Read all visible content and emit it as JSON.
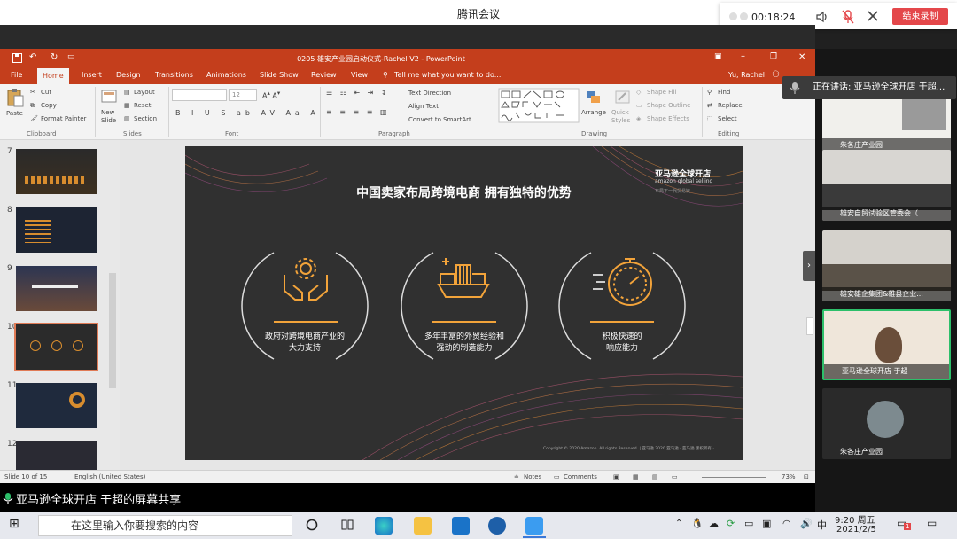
{
  "meeting": {
    "title": "腾讯会议",
    "time": "00:18:24",
    "end_label": "结束录制",
    "speaking_prefix": "正在讲话: 亚马逊全球开店 于超..."
  },
  "ppt": {
    "window_title": "0205 雄安产业园启动仪式-Rachel V2 - PowerPoint",
    "user": "Yu, Rachel",
    "tabs": [
      "File",
      "Home",
      "Insert",
      "Design",
      "Transitions",
      "Animations",
      "Slide Show",
      "Review",
      "View"
    ],
    "tell_me": "Tell me what you want to do...",
    "clipboard": {
      "paste": "Paste",
      "cut": "Cut",
      "copy": "Copy",
      "format_painter": "Format Painter",
      "group": "Clipboard"
    },
    "slides_group": {
      "new_slide": "New Slide",
      "layout": "Layout",
      "reset": "Reset",
      "section": "Section",
      "group": "Slides"
    },
    "font": {
      "size": "12",
      "group": "Font"
    },
    "paragraph": {
      "text_direction": "Text Direction",
      "align_text": "Align Text",
      "smartart": "Convert to SmartArt",
      "group": "Paragraph"
    },
    "drawing": {
      "arrange": "Arrange",
      "quick_styles": "Quick Styles",
      "fill": "Shape Fill",
      "outline": "Shape Outline",
      "effects": "Shape Effects",
      "group": "Drawing"
    },
    "editing": {
      "find": "Find",
      "replace": "Replace",
      "select": "Select",
      "group": "Editing"
    },
    "thumb_numbers": [
      "7",
      "8",
      "9",
      "10",
      "11",
      "12"
    ],
    "status": {
      "slide": "Slide 10 of 15",
      "lang": "English (United States)",
      "notes": "Notes",
      "comments": "Comments",
      "zoom": "73%"
    }
  },
  "slide": {
    "title": "中国卖家布局跨境电商  拥有独特的优势",
    "logo_cn": "亚马逊全球开店",
    "logo_en": "amazon global selling",
    "logo_sub": "布局下一代贸易链",
    "items": [
      {
        "icon": "gear-hands-icon",
        "line1": "政府对跨境电商产业的",
        "line2": "大力支持"
      },
      {
        "icon": "cargo-ship-icon",
        "line1": "多年丰富的外贸经验和",
        "line2": "强劲的制造能力"
      },
      {
        "icon": "stopwatch-icon",
        "line1": "积极快速的",
        "line2": "响应能力"
      }
    ],
    "copyright": "Copyright © 2020 Amazon. All rights Reserved. | 亚马逊 2020 亚马逊 · 亚马逊 版权所有 ·"
  },
  "share": "亚马逊全球开店 于超的屏幕共享",
  "participants": [
    {
      "name": "朱各庄产业园"
    },
    {
      "name": "雄安自贸试验区管委会（..."
    },
    {
      "name": "雄安雄企集团&雄县企业..."
    },
    {
      "name": "亚马逊全球开店 于超"
    },
    {
      "name": "朱各庄产业园"
    }
  ],
  "taskbar": {
    "search_placeholder": "在这里输入你要搜索的内容",
    "time": "9:20 周五",
    "date": "2021/2/5",
    "ime": "中",
    "notif": "1"
  },
  "colors": {
    "accent": "#c43e1c",
    "slide_bg": "#303030",
    "gold": "#f2a33a",
    "record": "#e4474a"
  }
}
